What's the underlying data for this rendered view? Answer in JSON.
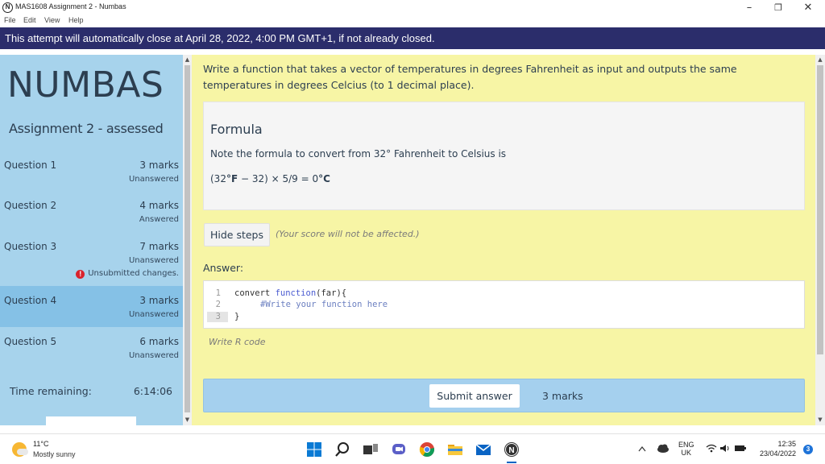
{
  "window": {
    "title": "MAS1608 Assignment 2 - Numbas",
    "logo_letter": "N",
    "minimize": "–",
    "maximize": "❐",
    "close": "✕"
  },
  "menu": [
    "File",
    "Edit",
    "View",
    "Help"
  ],
  "banner": "This attempt will automatically close at April 28, 2022, 4:00 PM GMT+1, if not already closed.",
  "sidebar": {
    "brand": "NUMBAS",
    "assignment_title": "Assignment 2 - assessed",
    "questions": [
      {
        "name": "Question 1",
        "marks": "3 marks",
        "status": "Unanswered",
        "warning": ""
      },
      {
        "name": "Question 2",
        "marks": "4 marks",
        "status": "Answered",
        "warning": ""
      },
      {
        "name": "Question 3",
        "marks": "7 marks",
        "status": "Unanswered",
        "warning": "Unsubmitted changes."
      },
      {
        "name": "Question 4",
        "marks": "3 marks",
        "status": "Unanswered",
        "warning": "",
        "active": true
      },
      {
        "name": "Question 5",
        "marks": "6 marks",
        "status": "Unanswered",
        "warning": ""
      }
    ],
    "warning_icon": "!",
    "time_label": "Time remaining:",
    "time_value": "6:14:06"
  },
  "main": {
    "prompt": "Write a function that takes a vector of temperatures in degrees Fahrenheit as input and outputs the same temperatures in degrees Celcius (to 1 decimal place).",
    "steps": {
      "heading": "Formula",
      "text": "Note the formula to convert from 32° Fahrenheit to Celsius is",
      "formula_pre": "(32",
      "formula_unit1": "°F",
      "formula_mid": " − 32) × 5/9 = 0",
      "formula_unit2": "°C"
    },
    "hide_steps_label": "Hide steps",
    "hide_steps_note": "(Your score will not be affected.)",
    "answer_label": "Answer:",
    "code_lines": [
      {
        "num": "1",
        "a": "convert ",
        "b": "function",
        "c": "(far){"
      },
      {
        "num": "2",
        "comment": "#Write your function here"
      },
      {
        "num": "3",
        "a": "}"
      }
    ],
    "editor_hint": "Write R code",
    "submit_label": "Submit answer",
    "submit_marks": "3 marks"
  },
  "taskbar": {
    "temperature": "11°C",
    "weather": "Mostly sunny",
    "lang1": "ENG",
    "lang2": "UK",
    "time": "12:35",
    "date": "23/04/2022",
    "notifications": "3",
    "icons": [
      "windows-start-icon",
      "search-icon",
      "task-view-icon",
      "teams-chat-icon",
      "chrome-icon",
      "file-explorer-icon",
      "mail-icon",
      "numbas-app-icon"
    ]
  }
}
